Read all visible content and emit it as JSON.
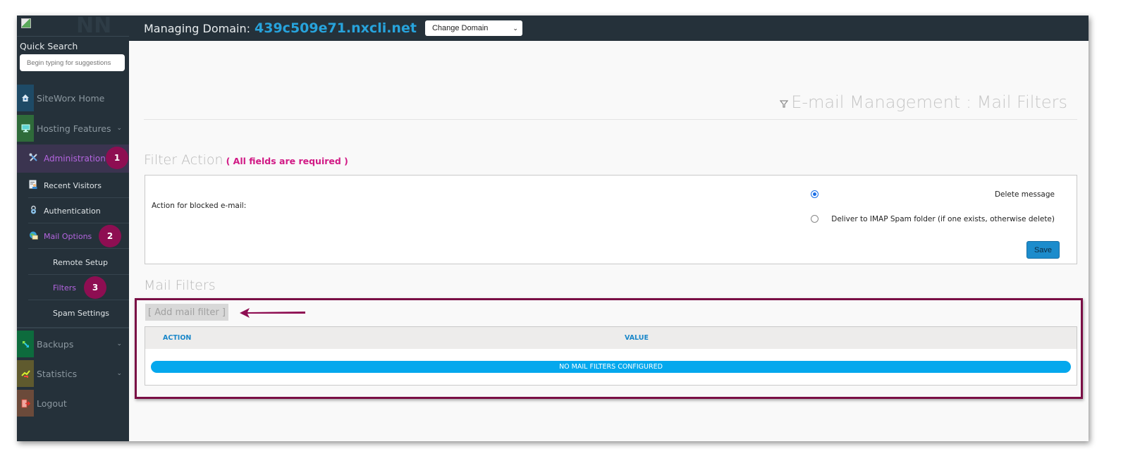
{
  "sidebar": {
    "quick_search_label": "Quick Search",
    "quick_search_placeholder": "Begin typing for suggestions",
    "items": [
      {
        "label": "SiteWorx Home",
        "icon": "house-icon",
        "color": "#1e4a66"
      },
      {
        "label": "Hosting Features",
        "icon": "monitor-icon",
        "color": "#2f6b3a",
        "chevron": "⌄"
      },
      {
        "label": "Administration",
        "icon": "tools-icon"
      },
      {
        "label": "Recent Visitors",
        "icon": "visitors-icon"
      },
      {
        "label": "Authentication",
        "icon": "lock-icon"
      },
      {
        "label": "Mail Options",
        "icon": "mail-globe-icon"
      },
      {
        "label": "Remote Setup"
      },
      {
        "label": "Filters"
      },
      {
        "label": "Spam Settings"
      },
      {
        "label": "Backups",
        "icon": "backup-arrows-icon",
        "color": "#0d6b3d",
        "chevron": "⌄"
      },
      {
        "label": "Statistics",
        "icon": "chart-icon",
        "color": "#5f5a2e",
        "chevron": "⌄"
      },
      {
        "label": "Logout",
        "icon": "logout-icon",
        "color": "#6b4a3a"
      }
    ],
    "badges": [
      "1",
      "2",
      "3"
    ]
  },
  "topbar": {
    "domain_label": "Managing Domain:",
    "domain_name": "439c509e71.nxcli.net",
    "change_domain": "Change Domain"
  },
  "page": {
    "title": "E-mail Management : Mail Filters",
    "filter_action_title": "Filter Action",
    "required_note": "( All fields are required )",
    "action_label": "Action for blocked e-mail:",
    "options": [
      {
        "label": "Delete message",
        "checked": true
      },
      {
        "label": "Deliver to IMAP Spam folder (if one exists, otherwise delete)",
        "checked": false
      }
    ],
    "save_label": "Save",
    "mail_filters_title": "Mail Filters",
    "add_filter_label": "[ Add mail filter ]",
    "table": {
      "columns": [
        "ACTION",
        "VALUE"
      ],
      "empty_message": "NO MAIL FILTERS CONFIGURED"
    }
  },
  "colors": {
    "accent": "#27a3dc",
    "annotation": "#8e0e52",
    "required": "#d11a85",
    "active_nav": "#b565e0",
    "empty_row": "#05a8ed"
  }
}
